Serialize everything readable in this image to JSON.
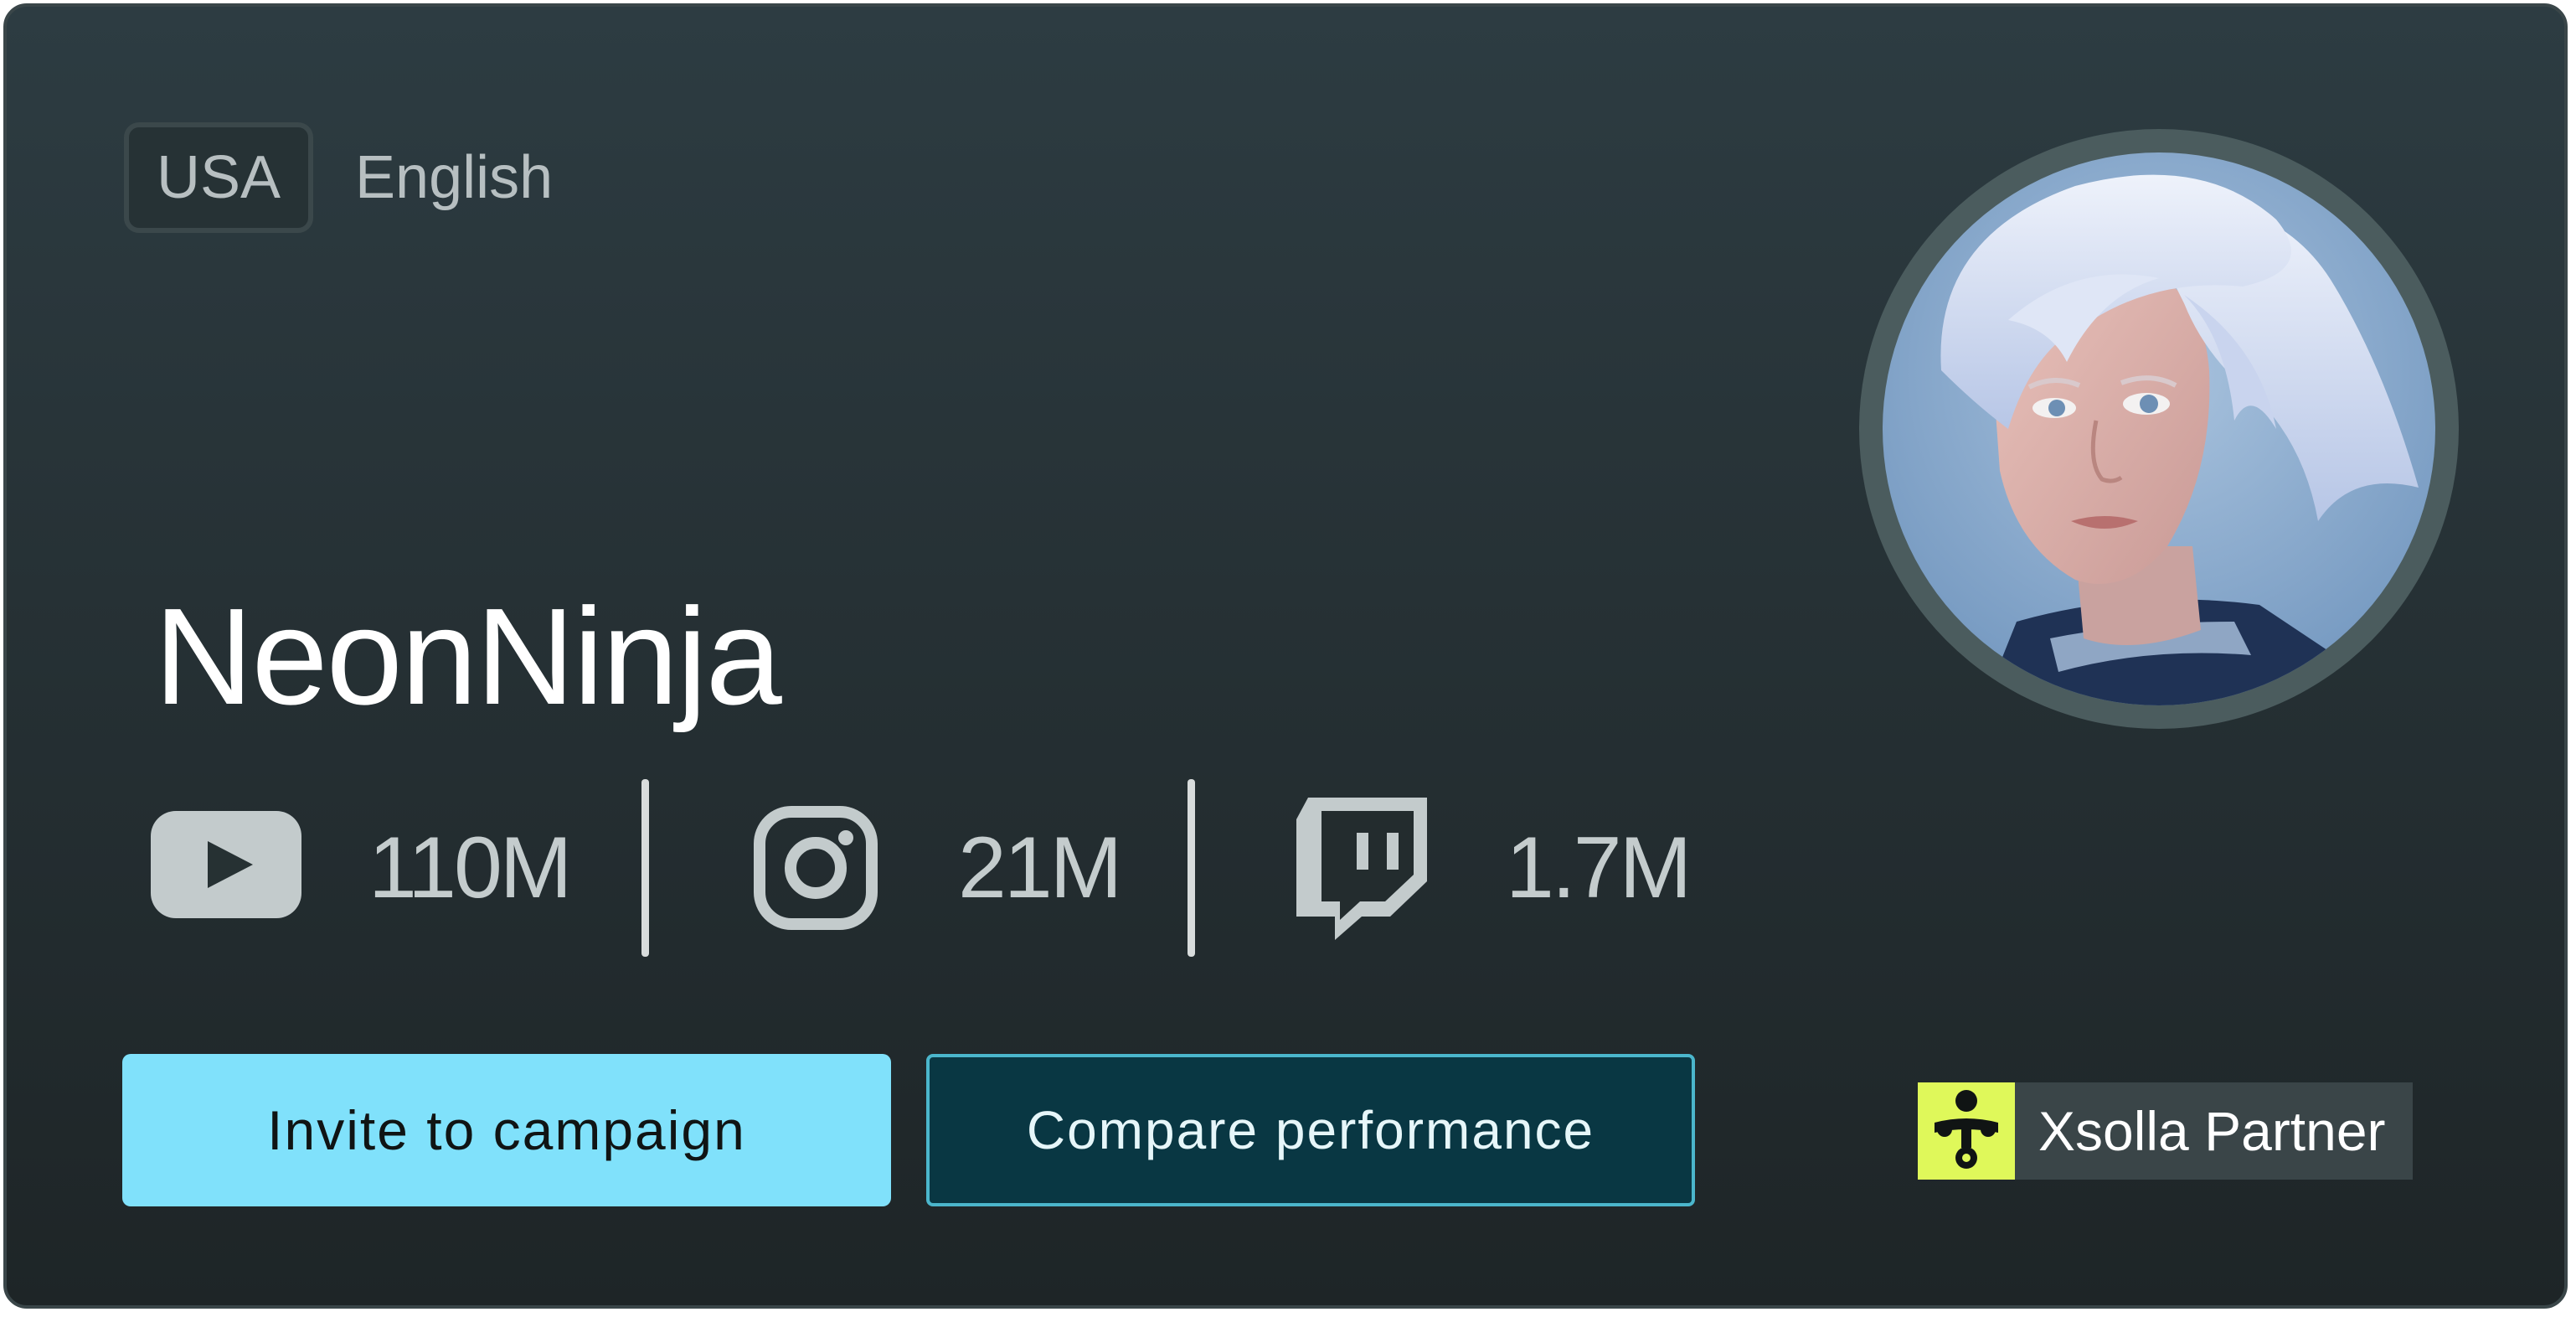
{
  "profile": {
    "country": "USA",
    "language": "English",
    "name": "NeonNinja"
  },
  "stats": [
    {
      "platform": "youtube",
      "icon": "youtube-icon",
      "value": "110M"
    },
    {
      "platform": "instagram",
      "icon": "instagram-icon",
      "value": "21M"
    },
    {
      "platform": "twitch",
      "icon": "twitch-icon",
      "value": "1.7M"
    }
  ],
  "actions": {
    "invite_label": "Invite to campaign",
    "compare_label": "Compare performance"
  },
  "partner": {
    "label": "Xsolla Partner",
    "icon": "xsolla-logo-icon"
  },
  "avatar": {
    "icon": "avatar-portrait"
  },
  "colors": {
    "card_bg_top": "#2d3c42",
    "card_bg_bottom": "#1e2527",
    "primary_button": "#80e1fb",
    "secondary_button": "#093743",
    "secondary_border": "#4bb6cc",
    "partner_accent": "#dff85a"
  }
}
